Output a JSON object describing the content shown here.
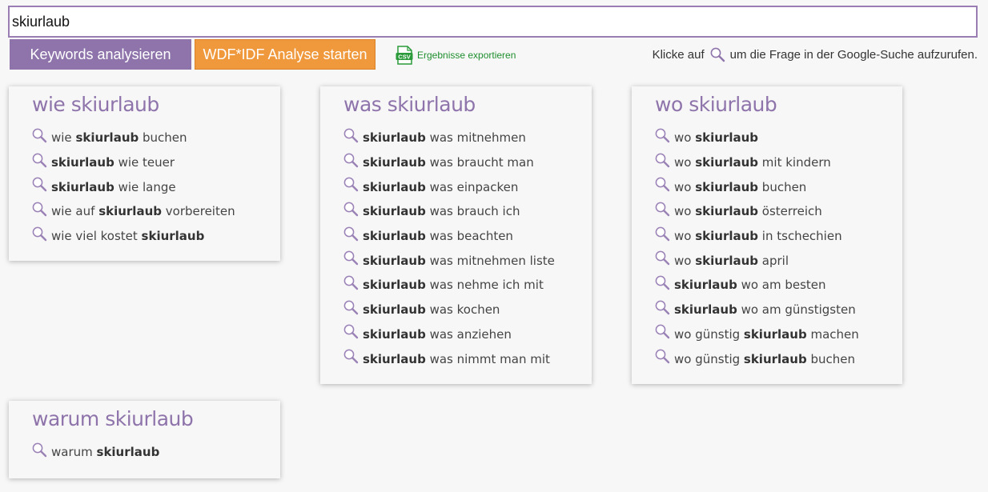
{
  "search": {
    "value": "skiurlaub"
  },
  "buttons": {
    "keywords": "Keywords analysieren",
    "wdf": "WDF*IDF Analyse starten"
  },
  "export": {
    "icon": "csv-file-icon",
    "label": "Ergebnisse exportieren",
    "color": "#1e8f2e"
  },
  "hint": {
    "before": "Klicke auf",
    "after": "um die Frage in der Google-Suche aufzurufen.",
    "icon": "magnifier-icon"
  },
  "colors": {
    "accent": "#8e74ab",
    "orange": "#f0983c"
  },
  "cards": [
    {
      "title": "wie skiurlaub",
      "items": [
        [
          "wie ",
          "skiurlaub",
          " buchen"
        ],
        [
          "",
          "skiurlaub",
          " wie teuer"
        ],
        [
          "",
          "skiurlaub",
          " wie lange"
        ],
        [
          "wie auf ",
          "skiurlaub",
          " vorbereiten"
        ],
        [
          "wie viel kostet ",
          "skiurlaub",
          ""
        ]
      ]
    },
    {
      "title": "was skiurlaub",
      "items": [
        [
          "",
          "skiurlaub",
          " was mitnehmen"
        ],
        [
          "",
          "skiurlaub",
          " was braucht man"
        ],
        [
          "",
          "skiurlaub",
          " was einpacken"
        ],
        [
          "",
          "skiurlaub",
          " was brauch ich"
        ],
        [
          "",
          "skiurlaub",
          " was beachten"
        ],
        [
          "",
          "skiurlaub",
          " was mitnehmen liste"
        ],
        [
          "",
          "skiurlaub",
          " was nehme ich mit"
        ],
        [
          "",
          "skiurlaub",
          " was kochen"
        ],
        [
          "",
          "skiurlaub",
          " was anziehen"
        ],
        [
          "",
          "skiurlaub",
          " was nimmt man mit"
        ]
      ]
    },
    {
      "title": "wo skiurlaub",
      "items": [
        [
          "wo ",
          "skiurlaub",
          ""
        ],
        [
          "wo ",
          "skiurlaub",
          " mit kindern"
        ],
        [
          "wo ",
          "skiurlaub",
          " buchen"
        ],
        [
          "wo ",
          "skiurlaub",
          " österreich"
        ],
        [
          "wo ",
          "skiurlaub",
          " in tschechien"
        ],
        [
          "wo ",
          "skiurlaub",
          " april"
        ],
        [
          "",
          "skiurlaub",
          " wo am besten"
        ],
        [
          "",
          "skiurlaub",
          " wo am günstigsten"
        ],
        [
          "wo günstig ",
          "skiurlaub",
          " machen"
        ],
        [
          "wo günstig ",
          "skiurlaub",
          " buchen"
        ]
      ]
    },
    {
      "title": "warum skiurlaub",
      "items": [
        [
          "warum ",
          "skiurlaub",
          ""
        ]
      ]
    }
  ]
}
